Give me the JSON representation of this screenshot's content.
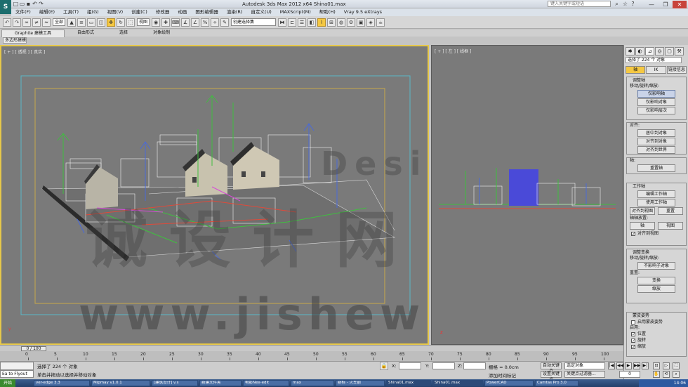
{
  "title_bar": {
    "app_logo": "S",
    "title": "Autodesk 3ds Max  2012 x64       Shina01.max",
    "search_placeholder": "键入关键字或短语",
    "win_min": "—",
    "win_max": "❐",
    "win_close": "✕"
  },
  "menu": [
    "文件(F)",
    "编辑(E)",
    "工具(T)",
    "组(G)",
    "视图(V)",
    "创建(C)",
    "修改器",
    "动画",
    "图形编辑器",
    "渲染(R)",
    "自定义(U)",
    "MAXScript(M)",
    "帮助(H)",
    "Vray 9.5 eXtrays"
  ],
  "toolbar": {
    "filter_select": "全部",
    "view_select": "视图",
    "named_sel": "创建选择集",
    "icons": [
      "undo-icon",
      "redo-icon",
      "link-icon",
      "unlink-icon",
      "bind-icon",
      "select-icon",
      "select-name-icon",
      "region-icon",
      "window-icon",
      "move-icon",
      "rotate-icon",
      "scale-icon"
    ]
  },
  "ribbon": {
    "tabs": [
      "Graphite 建模工具",
      "自由形式",
      "选择",
      "对象绘制"
    ],
    "subtab": "多边形建模"
  },
  "viewports": {
    "persp_label": "[ + ] [ 透视 ] [ 真实 ]",
    "left_label": "[ + ] [ 左 ] [ 线框 ]",
    "watermark_top": "Designer",
    "watermark_cn": "诚 设 计 网",
    "watermark_bottom": "www.jishewu.com"
  },
  "command_panel": {
    "status": "选择了 224 个 对象",
    "tabs3": [
      "轴",
      "IK",
      "链接信息"
    ],
    "rollout1": {
      "title": "调整轴",
      "sub": "移动/旋转/缩放:",
      "buttons": [
        "仅影响轴",
        "仅影响对象",
        "仅影响层次"
      ]
    },
    "rollout2": {
      "title": "对齐:",
      "buttons": [
        "居中到对象",
        "对齐到对象",
        "对齐到世界"
      ]
    },
    "rollout3": {
      "title": "轴:",
      "buttons": [
        "重置轴"
      ]
    },
    "rollout4": {
      "title": "工作轴",
      "buttons": [
        "编辑工作轴",
        "使用工作轴",
        "对齐到视图",
        "重置"
      ],
      "sub": "轴轴放置:",
      "pair": [
        "轴",
        "视图"
      ],
      "check": "对齐到视图"
    },
    "rollout5": {
      "title": "调整变换",
      "sub": "移动/旋转/缩放:",
      "buttons": [
        "不影响子对象"
      ],
      "sub2": "重置:",
      "buttons2": [
        "变换",
        "缩放"
      ]
    },
    "rollout6": {
      "title": "蒙皮姿势",
      "check0": "启用蒙皮姿势",
      "sub": "启用:",
      "checks": [
        "位置",
        "旋转",
        "缩放"
      ]
    }
  },
  "timeline": {
    "handle": "0 / 100",
    "ticks": [
      "0",
      "5",
      "10",
      "15",
      "20",
      "25",
      "30",
      "35",
      "40",
      "45",
      "50",
      "55",
      "60",
      "65",
      "70",
      "75",
      "80",
      "85",
      "90",
      "95",
      "100"
    ]
  },
  "status": {
    "maxscript": "",
    "maxscript2": "Ea to Flyout",
    "selected": "选择了 224 个 对象",
    "hint": "单击并拖动以选择并移动对象",
    "x_label": "X:",
    "y_label": "Y:",
    "z_label": "Z:",
    "grid": "栅格 = 0.0cm",
    "addkey": "添加时间标记",
    "autokey": "自动关键点",
    "setkey": "设置关键点",
    "selset": "选定对象",
    "keyfilter": "关键点过滤器...",
    "frame": "0",
    "playback": [
      "|◀",
      "◀◀",
      "▶",
      "▶▶",
      "▶|"
    ]
  },
  "taskbar": {
    "start": "开始",
    "tasks": [
      "ver-edge 3.3",
      "Mipmay v1.0.1",
      "[建筑设计] v.s",
      "新建文件夹",
      "电影Nex-edit",
      "max",
      "新标 - 火车前",
      "Shina01.max",
      "Shina01.max",
      "PowerCAD",
      "Camtas Pro 3.0"
    ],
    "tray": "14:06"
  }
}
